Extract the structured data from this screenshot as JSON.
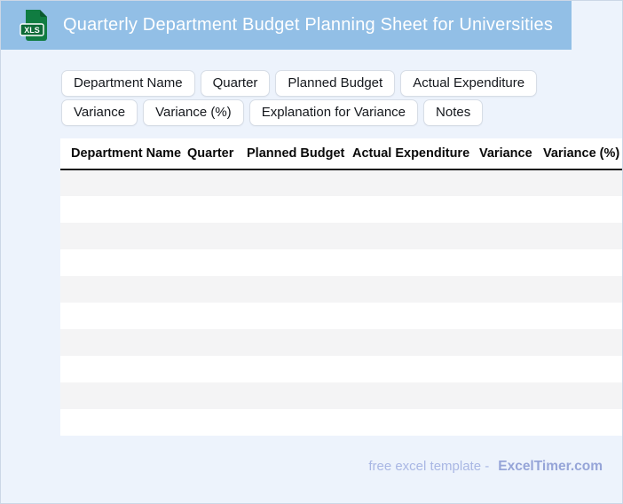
{
  "header": {
    "title": "Quarterly Department Budget Planning Sheet for Universities",
    "file_icon_label": "XLS"
  },
  "chips": [
    "Department Name",
    "Quarter",
    "Planned Budget",
    "Actual Expenditure",
    "Variance",
    "Variance (%)",
    "Explanation for Variance",
    "Notes"
  ],
  "table": {
    "columns": [
      "Department Name",
      "Quarter",
      "Planned Budget",
      "Actual Expenditure",
      "Variance",
      "Variance (%)"
    ],
    "empty_row_count": 10
  },
  "footer": {
    "text": "free excel template -",
    "brand": "ExcelTimer.com"
  },
  "colors": {
    "header_bg": "#92bfe6",
    "page_bg": "#edf3fc",
    "table_stripe": "#f4f4f5",
    "icon_green": "#107c41",
    "icon_green_dark": "#0a5a2f",
    "icon_badge_green": "#0e6b37",
    "footer_text": "#a9b7e4",
    "footer_brand": "#96a5d8"
  }
}
